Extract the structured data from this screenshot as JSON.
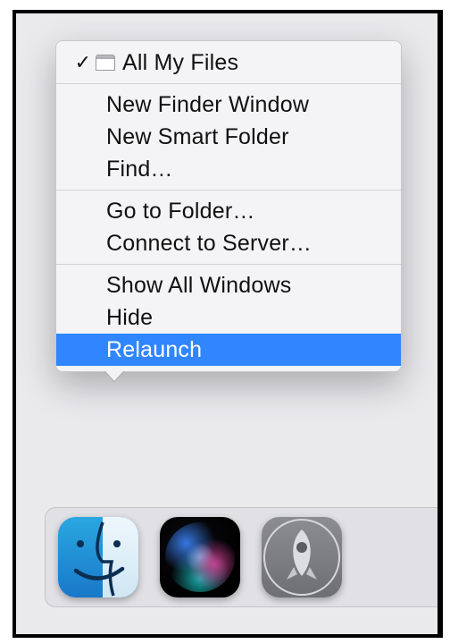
{
  "menu": {
    "checked_label": "All My Files",
    "group2": [
      "New Finder Window",
      "New Smart Folder",
      "Find…"
    ],
    "group3": [
      "Go to Folder…",
      "Connect to Server…"
    ],
    "group4": [
      "Show All Windows",
      "Hide",
      "Relaunch"
    ],
    "selected_index": 2
  },
  "dock": {
    "apps": [
      {
        "name": "finder",
        "running": true
      },
      {
        "name": "siri",
        "running": false
      },
      {
        "name": "launchpad",
        "running": false
      }
    ]
  }
}
